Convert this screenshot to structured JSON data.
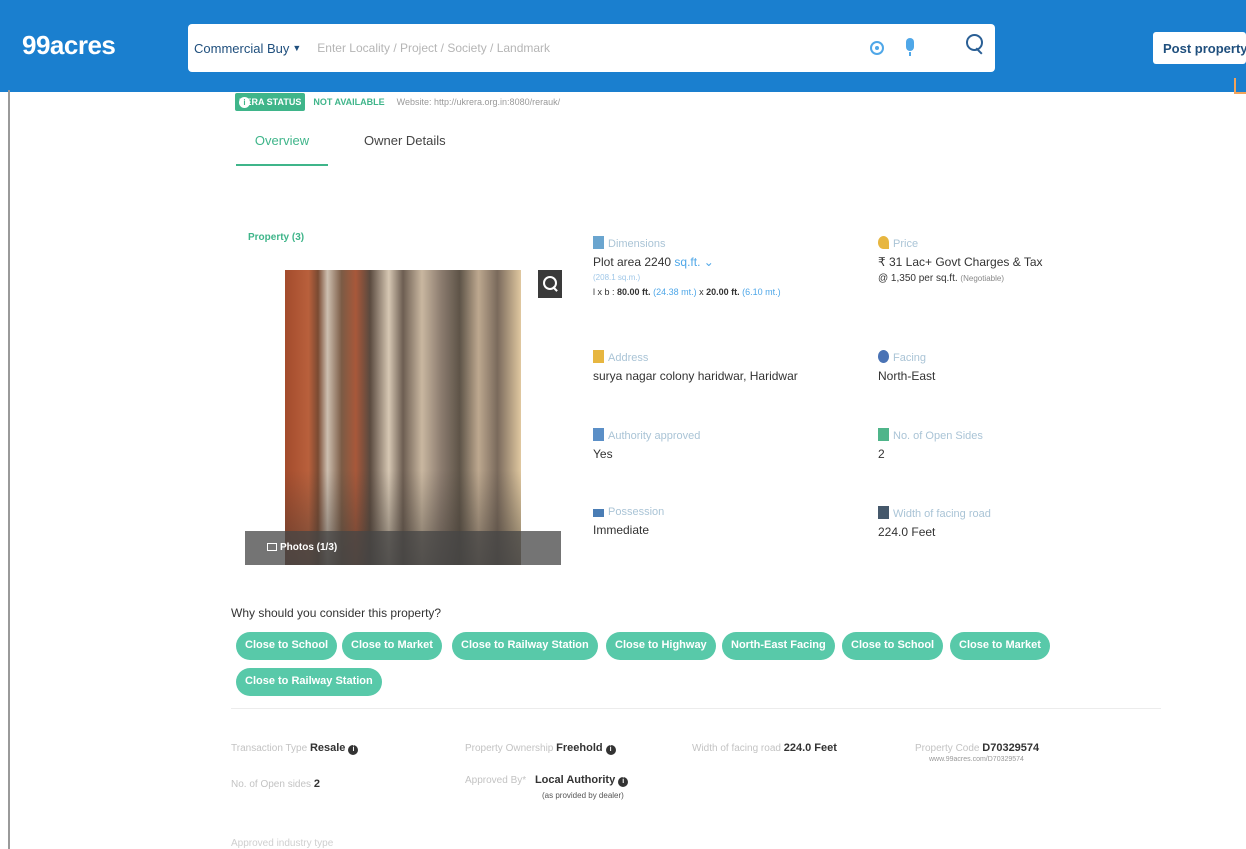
{
  "header": {
    "logo": "99acres",
    "search_type": "Commercial Buy",
    "search_placeholder": "Enter Locality / Project / Society / Landmark",
    "post_property": "Post property"
  },
  "rera": {
    "badge": "RERA STATUS",
    "status": "NOT AVAILABLE",
    "website": "Website: http://ukrera.org.in:8080/rerauk/"
  },
  "tabs": [
    {
      "label": "Overview"
    },
    {
      "label": "Owner Details"
    }
  ],
  "property": {
    "label": "Property (3)",
    "photos": "Photos (1/3)"
  },
  "details": {
    "dimensions": {
      "label": "Dimensions",
      "value": "Plot area 2240",
      "unit": "sq.ft.",
      "sub": "(208.1 sq.m.)",
      "lxb": "l x b :",
      "length": "80.00 ft.",
      "length_m": "(24.38 mt.)",
      "x": "x",
      "breadth": "20.00 ft.",
      "breadth_m": "(6.10 mt.)"
    },
    "price": {
      "label": "Price",
      "value": "₹ 31 Lac+ Govt Charges & Tax",
      "rate": "@ 1,350 per sq.ft.",
      "negotiable": "(Negotiable)"
    },
    "address": {
      "label": "Address",
      "value": "surya nagar colony haridwar, Haridwar"
    },
    "facing": {
      "label": "Facing",
      "value": "North-East"
    },
    "authority": {
      "label": "Authority approved",
      "value": "Yes"
    },
    "open_sides": {
      "label": "No. of Open Sides",
      "value": "2"
    },
    "possession": {
      "label": "Possession",
      "value": "Immediate"
    },
    "road_width": {
      "label": "Width of facing road",
      "value": "224.0 Feet"
    }
  },
  "why": {
    "title": "Why should you consider this property?",
    "tags": [
      "Close to School",
      "Close to Market",
      "Close to Railway Station",
      "Close to Highway",
      "North-East Facing",
      "Close to School",
      "Close to Market",
      "Close to Railway Station"
    ]
  },
  "info": {
    "transaction_label": "Transaction Type",
    "transaction_value": "Resale",
    "ownership_label": "Property Ownership",
    "ownership_value": "Freehold",
    "road_label": "Width of facing road",
    "road_value": "224.0 Feet",
    "code_label": "Property Code",
    "code_value": "D70329574",
    "code_url": "www.99acres.com/D70329574",
    "open_sides_label": "No. of Open sides",
    "open_sides_value": "2",
    "approved_label": "Approved By*",
    "approved_value": "Local Authority",
    "approved_note": "(as provided by dealer)",
    "industry_label": "Approved industry type"
  },
  "colors": {
    "header_blue": "#1a7fcf",
    "accent_green": "#3fb58a",
    "tag_green": "#58c9a9",
    "link_blue": "#4fa7e8"
  },
  "icons": [
    "location-icon",
    "microphone-icon",
    "search-icon",
    "zoom-icon",
    "info-icon",
    "image-icon",
    "dimensions-icon",
    "price-icon",
    "address-icon",
    "facing-icon",
    "authority-icon",
    "open-sides-icon",
    "possession-icon",
    "road-icon"
  ]
}
